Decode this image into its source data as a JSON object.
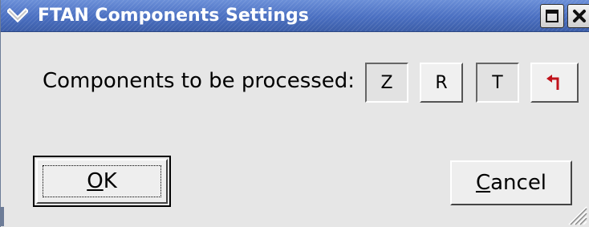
{
  "window": {
    "title": "FTAN Components Settings"
  },
  "components": {
    "label": "Components to be processed:",
    "buttons": [
      {
        "label": "Z",
        "state": "pressed"
      },
      {
        "label": "R",
        "state": "released"
      },
      {
        "label": "T",
        "state": "pressed"
      }
    ],
    "undo_icon": "undo-arrow-icon"
  },
  "actions": {
    "ok_mnemonic": "O",
    "ok_rest": "K",
    "cancel_mnemonic": "C",
    "cancel_rest": "ancel"
  },
  "colors": {
    "titlebar": "#4a6fc1",
    "dialog_bg": "#e6e6e6",
    "undo_arrow": "#c0121b"
  }
}
